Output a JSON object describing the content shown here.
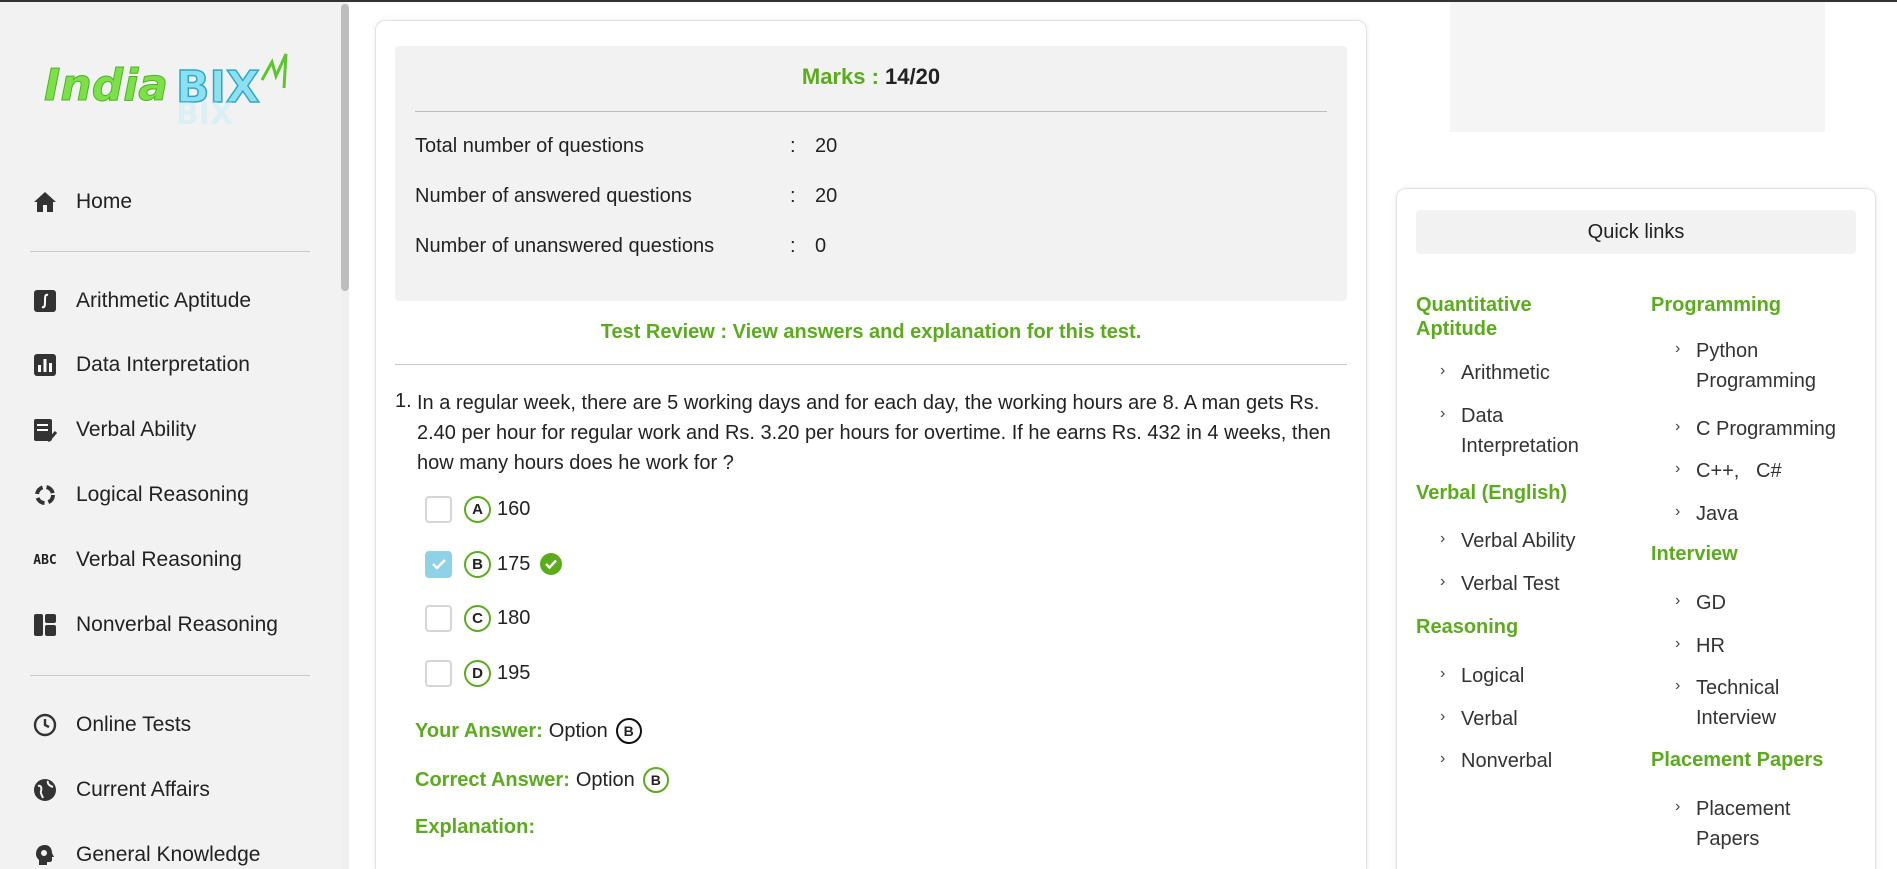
{
  "sidebar": {
    "logo_text": "IndiaBIX",
    "items": [
      {
        "label": "Home",
        "icon": "home-icon"
      },
      {
        "label": "Arithmetic Aptitude",
        "icon": "integral-icon"
      },
      {
        "label": "Data Interpretation",
        "icon": "bar-chart-icon"
      },
      {
        "label": "Verbal Ability",
        "icon": "document-check-icon"
      },
      {
        "label": "Logical Reasoning",
        "icon": "cycle-icon"
      },
      {
        "label": "Verbal Reasoning",
        "icon": "abc-icon",
        "icon_text": "ABC"
      },
      {
        "label": "Nonverbal Reasoning",
        "icon": "layout-icon"
      },
      {
        "label": "Online Tests",
        "icon": "clock-icon"
      },
      {
        "label": "Current Affairs",
        "icon": "globe-icon"
      },
      {
        "label": "General Knowledge",
        "icon": "head-bulb-icon"
      }
    ]
  },
  "summary": {
    "marks_label": "Marks :",
    "marks_value": "14/20",
    "rows": [
      {
        "label": "Total number of questions",
        "colon": ":",
        "value": "20"
      },
      {
        "label": "Number of answered questions",
        "colon": ":",
        "value": "20"
      },
      {
        "label": "Number of unanswered questions",
        "colon": ":",
        "value": "0"
      }
    ]
  },
  "review": {
    "text": "Test Review : View answers and explanation for this test."
  },
  "question": {
    "number": "1.",
    "text": "In a regular week, there are 5 working days and for each day, the working hours are 8. A man gets Rs. 2.40 per hour for regular work and Rs. 3.20 per hours for overtime. If he earns Rs. 432 in 4 weeks, then how many hours does he work for ?",
    "options": [
      {
        "letter": "A",
        "value": "160",
        "checked": false
      },
      {
        "letter": "B",
        "value": "175",
        "checked": true
      },
      {
        "letter": "C",
        "value": "180",
        "checked": false
      },
      {
        "letter": "D",
        "value": "195",
        "checked": false
      }
    ],
    "your_answer_label": "Your Answer:",
    "your_answer_text": "Option",
    "your_answer_letter": "B",
    "correct_answer_label": "Correct Answer:",
    "correct_answer_text": "Option",
    "correct_answer_letter": "B",
    "explanation_label": "Explanation:"
  },
  "quick_links": {
    "title": "Quick links",
    "left": [
      {
        "category": "Quantitative Aptitude",
        "links": [
          "Arithmetic",
          "Data Interpretation"
        ]
      },
      {
        "category": "Verbal (English)",
        "links": [
          "Verbal Ability",
          "Verbal Test"
        ]
      },
      {
        "category": "Reasoning",
        "links": [
          "Logical",
          "Verbal",
          "Nonverbal"
        ]
      }
    ],
    "right": [
      {
        "category": "Programming",
        "links": [
          "Python Programming",
          "C Programming",
          "C++,   C#",
          "Java"
        ]
      },
      {
        "category": "Interview",
        "links": [
          "GD",
          "HR",
          "Technical Interview"
        ]
      },
      {
        "category": "Placement Papers",
        "links": [
          "Placement Papers"
        ]
      }
    ]
  },
  "colors": {
    "accent": "#5aac1c",
    "checked": "#8fd2e8",
    "sidebar_bg": "#f2f2f2"
  }
}
